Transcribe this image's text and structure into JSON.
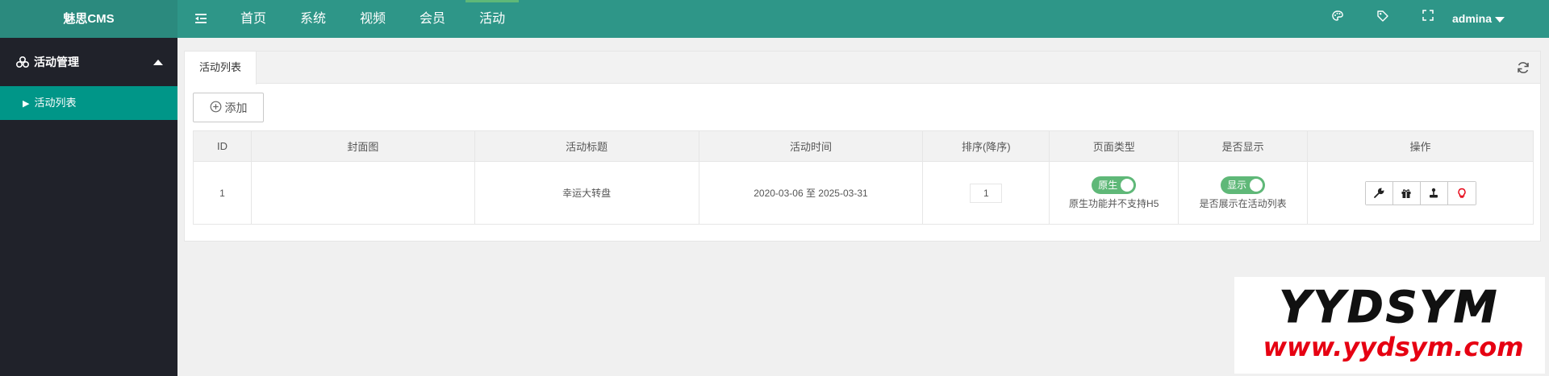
{
  "app": {
    "logo": "魅思CMS"
  },
  "nav": {
    "items": [
      {
        "label": "首页"
      },
      {
        "label": "系统"
      },
      {
        "label": "视频"
      },
      {
        "label": "会员"
      },
      {
        "label": "活动"
      }
    ],
    "active_index": 4
  },
  "header": {
    "user": "admina"
  },
  "sidebar": {
    "group_label": "活动管理",
    "items": [
      {
        "label": "活动列表"
      }
    ]
  },
  "main": {
    "tab_label": "活动列表",
    "add_button": "添加",
    "table": {
      "columns": [
        "ID",
        "封面图",
        "活动标题",
        "活动时间",
        "排序(降序)",
        "页面类型",
        "是否显示",
        "操作"
      ],
      "rows": [
        {
          "id": "1",
          "cover": "",
          "title": "幸运大转盘",
          "time": "2020-03-06 至 2025-03-31",
          "sort": "1",
          "page_type_switch": "原生",
          "page_type_desc": "原生功能并不支持H5",
          "display_switch": "显示",
          "display_desc": "是否展示在活动列表"
        }
      ]
    }
  },
  "watermark": {
    "line1": "YYDSYM",
    "line2": "www.yydsym.com"
  },
  "colors": {
    "header": "#2e9688",
    "sidebar": "#20222a",
    "accent": "#009688",
    "switch_on": "#5fb878",
    "watermark_red": "#e60012"
  },
  "icons": [
    "menu-fold-icon",
    "palette-icon",
    "tag-icon",
    "fullscreen-icon",
    "refresh-icon",
    "add-circle-icon",
    "wrench-icon",
    "gift-icon",
    "joystick-icon",
    "bulb-icon"
  ]
}
